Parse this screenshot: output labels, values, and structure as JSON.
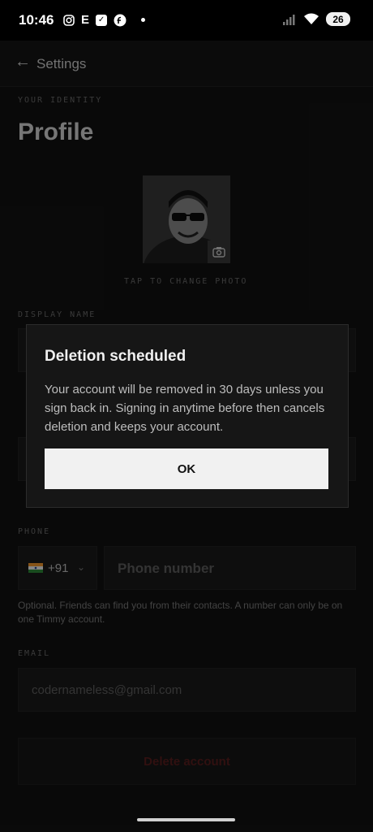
{
  "status": {
    "time": "10:46",
    "battery": "26",
    "notif_icons": [
      "instagram-icon",
      "e-icon",
      "check-icon",
      "f-icon",
      "dot-icon"
    ]
  },
  "appbar": {
    "title": "Settings",
    "back_icon": "arrow-left-icon"
  },
  "profile": {
    "section_label": "YOUR IDENTITY",
    "title": "Profile",
    "change_photo": "TAP TO CHANGE PHOTO"
  },
  "fields": {
    "display_name_label": "DISPLAY NAME",
    "phone_label": "PHONE",
    "country_code": "+91",
    "phone_placeholder": "Phone number",
    "phone_helper": "Optional. Friends can find you from their contacts. A number can only be on one Timmy account.",
    "email_label": "EMAIL",
    "email_value": "codernameless@gmail.com"
  },
  "delete_button": "Delete account",
  "dialog": {
    "title": "Deletion scheduled",
    "body": "Your account will be removed in 30 days unless you sign back in. Signing in anytime before then cancels deletion and keeps your account.",
    "ok": "OK"
  }
}
